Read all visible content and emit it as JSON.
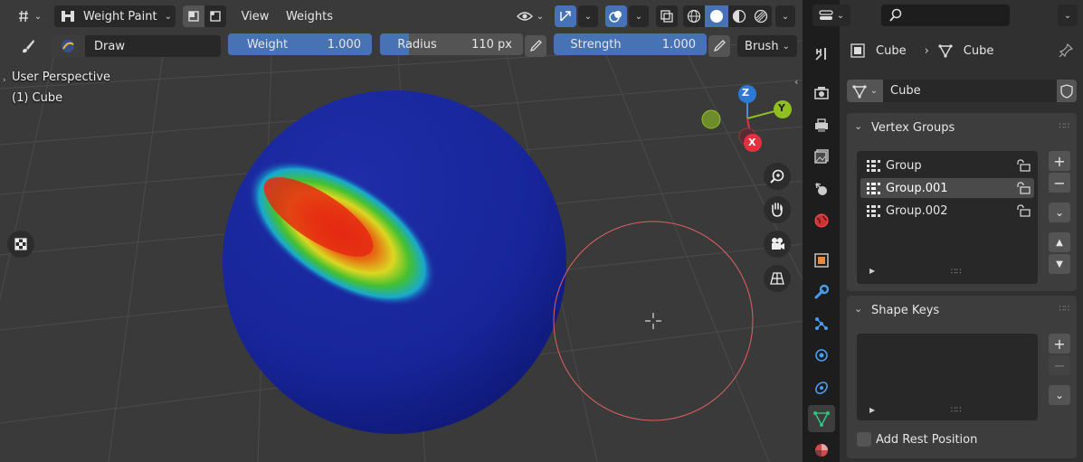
{
  "header": {
    "mode": "Weight Paint",
    "menus": [
      "View",
      "Weights"
    ]
  },
  "tool_settings": {
    "brush_name": "Draw",
    "weight": {
      "label": "Weight",
      "value": "1.000"
    },
    "radius": {
      "label": "Radius",
      "value": "110 px"
    },
    "strength": {
      "label": "Strength",
      "value": "1.000"
    },
    "brush_menu": "Brush"
  },
  "viewport": {
    "view_name": "User Perspective",
    "object_label": "(1) Cube",
    "gizmo_axes": {
      "x": "X",
      "y": "Y",
      "z": "Z"
    }
  },
  "properties": {
    "breadcrumb": [
      "Cube",
      "Cube"
    ],
    "mesh_name": "Cube",
    "vertex_groups": {
      "title": "Vertex Groups",
      "items": [
        {
          "name": "Group",
          "active": false
        },
        {
          "name": "Group.001",
          "active": true
        },
        {
          "name": "Group.002",
          "active": false
        }
      ]
    },
    "shape_keys": {
      "title": "Shape Keys"
    },
    "add_rest_position": {
      "label": "Add Rest Position",
      "checked": false
    }
  },
  "colors": {
    "accent": "#4772b3",
    "viewport_bg": "#3a3a3a",
    "panel_bg": "#3d3d3d",
    "sphere": "#1a2a9a",
    "brush_circle": "#e06060"
  }
}
